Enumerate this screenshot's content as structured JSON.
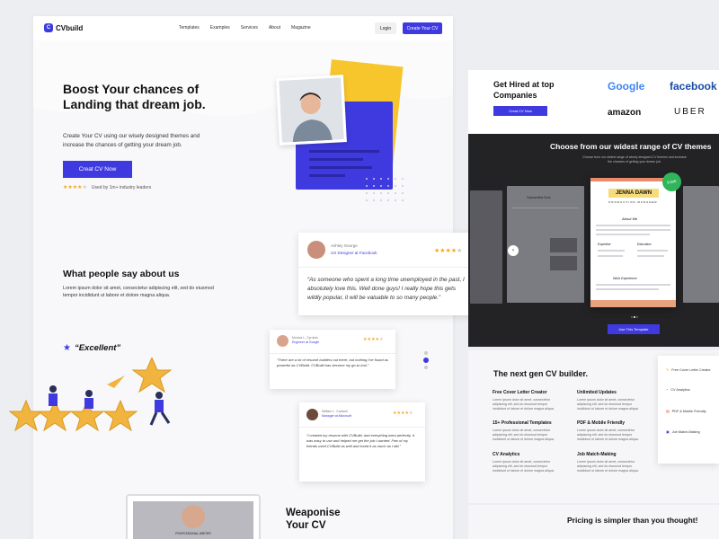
{
  "nav": {
    "brand": "CVbuild",
    "brand_icon": "C",
    "links": [
      "Templates",
      "Examples",
      "Services",
      "About",
      "Magazine"
    ],
    "login": "Login",
    "cta": "Create Your CV"
  },
  "hero": {
    "title": "Boost Your chances of Landing that dream job.",
    "subtitle": "Create Your CV using our wisely designed themes and increase the chances of getting your dream job.",
    "button": "Creat CV Now",
    "rating_stars": 4,
    "rating_text": "Used by 1m+ industry leaders"
  },
  "testimonials": {
    "title": "What people say about us",
    "subtitle": "Lorem ipsum dolor sit amet, consectetur adipiscing elit, sed do eiusmod tempor incididunt ut labore et dolore magna aliqua.",
    "excellent": "“Excellent”",
    "cards": [
      {
        "name": "Ashley George",
        "role": "UX Designer at Facebook",
        "stars": 4,
        "quote": "“As someone who spent a long time unemployed in the past, I absolutely love this. Well done guys! I really hope this gets wildly popular, it will be valuable to so many people.”"
      },
      {
        "name": "Monica L. Cyrulnis",
        "role": "Engineer at Google",
        "stars": 4,
        "quote": "“There are a lot of résumé builders out there, but nothing I've found as powerful as CVBuild. CVBuild has become my go-to tool.”"
      },
      {
        "name": "William L. Cadwell",
        "role": "Manager at Microsoft",
        "stars": 4,
        "quote": "“I created my resume with CVBuild, and everything went perfectly. It was easy to use and helped me get the job I wanted. Few of my friends used CVBuild as well and loved it as much as I did.”"
      }
    ]
  },
  "weaponise": {
    "title": "Weaponise Your CV",
    "mock_caption": "PROFESSIONAL WRITER"
  },
  "hired": {
    "title": "Get Hired at top Companies",
    "button": "Creat CV Now",
    "logos": [
      "Google",
      "facebook",
      "amazon",
      "UBER"
    ]
  },
  "templates": {
    "title": "Choose from our widest range of CV themes",
    "subtitle": "Choose from our widest range of wisely designed CV themes and increase the chances of getting your dream job.",
    "featured_name": "JENNA DAWN",
    "featured_role": "PRODUCTION MANAGER",
    "badge": "Free",
    "side_name": "Samantha Doe",
    "button": "Use This Template",
    "section_labels": [
      "About Me",
      "Expertise",
      "Education",
      "Work Experience"
    ]
  },
  "features": {
    "title": "The next gen CV builder.",
    "items": [
      {
        "title": "Free Cover Letter Creator",
        "text": "Lorem ipsum dolor sit amet, consectetur adipiscing elit, sed do eiusmod tempor incididunt ut labore et dolore magna aliqua."
      },
      {
        "title": "Unlimited Updates",
        "text": "Lorem ipsum dolor sit amet, consectetur adipiscing elit, sed do eiusmod tempor incididunt ut labore et dolore magna aliqua."
      },
      {
        "title": "15+ Professional Templates",
        "text": "Lorem ipsum dolor sit amet, consectetur adipiscing elit, sed do eiusmod tempor incididunt ut labore et dolore magna aliqua."
      },
      {
        "title": "PDF & Mobile Friendly",
        "text": "Lorem ipsum dolor sit amet, consectetur adipiscing elit, sed do eiusmod tempor incididunt ut labore et dolore magna aliqua."
      },
      {
        "title": "CV Analytics",
        "text": "Lorem ipsum dolor sit amet, consectetur adipiscing elit, sed do eiusmod tempor incididunt ut labore et dolore magna aliqua."
      },
      {
        "title": "Job Match-Making",
        "text": "Lorem ipsum dolor sit amet, consectetur adipiscing elit, sed do eiusmod tempor incididunt ut labore et dolore magna aliqua."
      }
    ],
    "side_list": [
      "Free Cover Letter Creator",
      "CV Analytics",
      "PDF & Mobile Friendly",
      "Job Match-Making"
    ]
  },
  "pricing": {
    "title": "Pricing is simpler than you thought!"
  },
  "colors": {
    "primary": "#3f3ae0",
    "yellow": "#f7c52c",
    "star": "#f5a623"
  }
}
